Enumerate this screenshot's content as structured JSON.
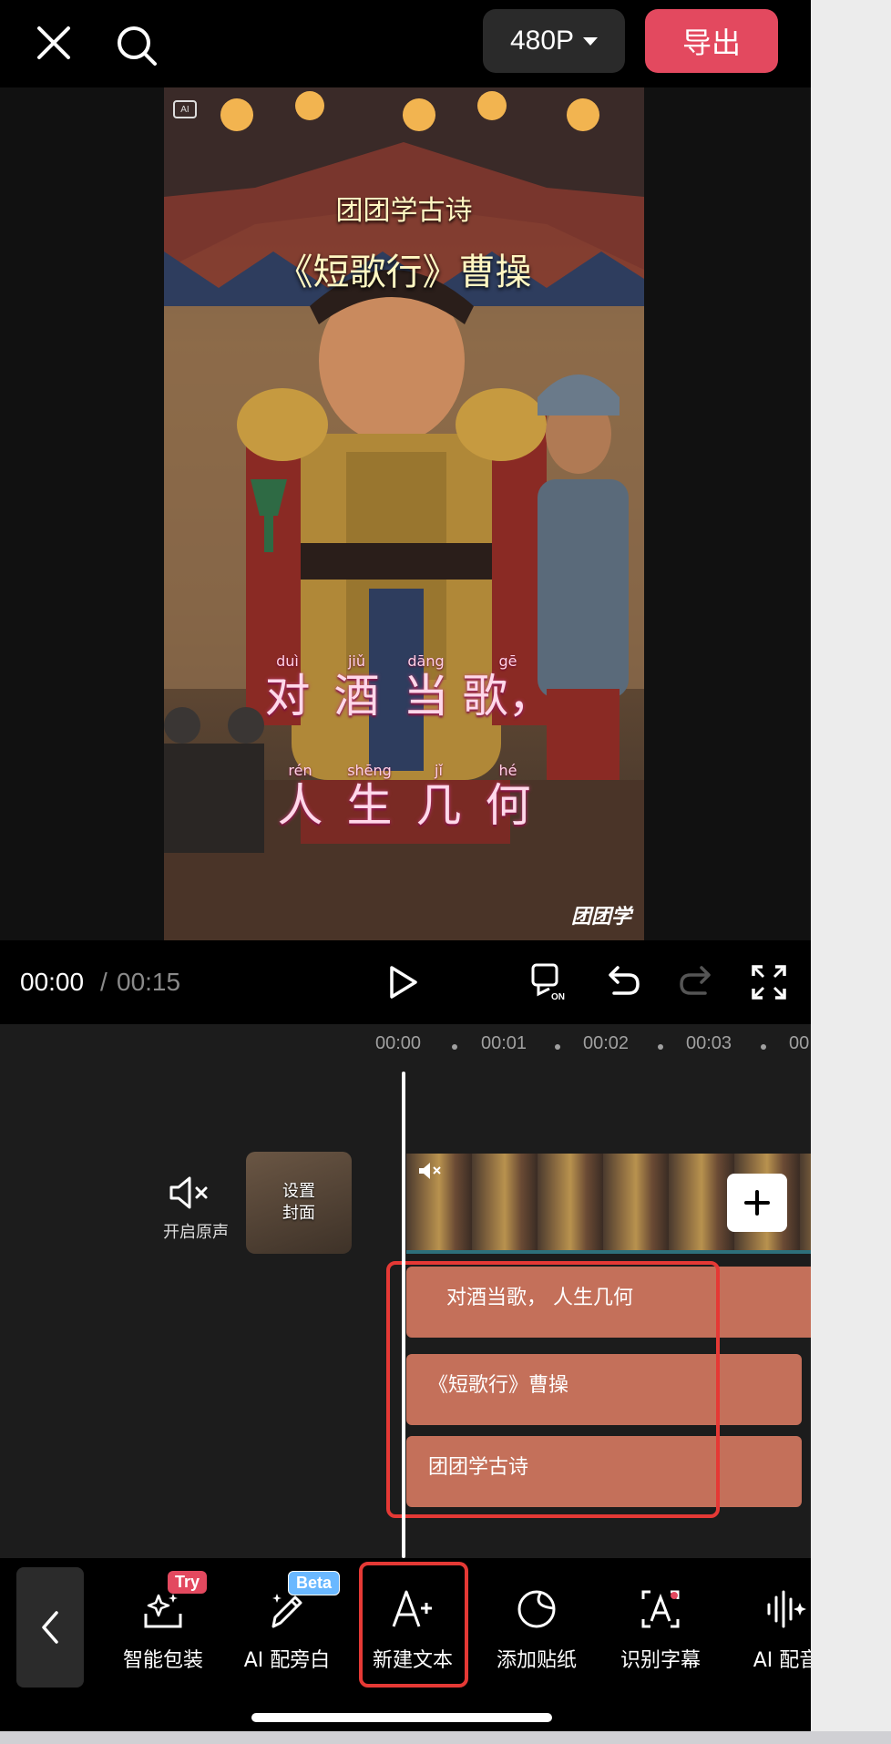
{
  "top_bar": {
    "resolution_label": "480P",
    "export_label": "导出"
  },
  "video": {
    "badge": "AI",
    "title_line1": "团团学古诗",
    "title_line2": "《短歌行》曹操",
    "line1": [
      {
        "pinyin": "duì",
        "hanzi": "对"
      },
      {
        "pinyin": "jiǔ",
        "hanzi": "酒"
      },
      {
        "pinyin": "dāng",
        "hanzi": "当"
      },
      {
        "pinyin": "gē",
        "hanzi": "歌，"
      }
    ],
    "line2": [
      {
        "pinyin": "rén",
        "hanzi": "人"
      },
      {
        "pinyin": "shēng",
        "hanzi": "生"
      },
      {
        "pinyin": "jǐ",
        "hanzi": "几"
      },
      {
        "pinyin": "hé",
        "hanzi": "何"
      }
    ],
    "watermark": "团团学"
  },
  "playbar": {
    "current_time": "00:00",
    "separator": "/",
    "total_time": "00:15"
  },
  "timeline": {
    "ticks": [
      "00:00",
      "00:01",
      "00:02",
      "00:03",
      "00"
    ],
    "mute_label": "开启原声",
    "cover_label_line1": "设置",
    "cover_label_line2": "封面",
    "text_clips": [
      "对酒当歌，  人生几何",
      "《短歌行》曹操",
      "团团学古诗"
    ]
  },
  "toolbar": {
    "tools": [
      {
        "label": "智能包装",
        "badge": "Try",
        "icon": "sparkle-box-icon"
      },
      {
        "label": "AI 配旁白",
        "badge": "Beta",
        "icon": "magic-pen-icon"
      },
      {
        "label": "新建文本",
        "icon": "add-text-icon"
      },
      {
        "label": "添加贴纸",
        "icon": "sticker-icon"
      },
      {
        "label": "识别字幕",
        "icon": "caption-recognize-icon"
      },
      {
        "label": "AI 配音",
        "icon": "ai-voice-icon"
      }
    ]
  },
  "colors": {
    "export": "#e3495f",
    "text_clip": "#c4705a",
    "highlight_box": "#e53935"
  }
}
